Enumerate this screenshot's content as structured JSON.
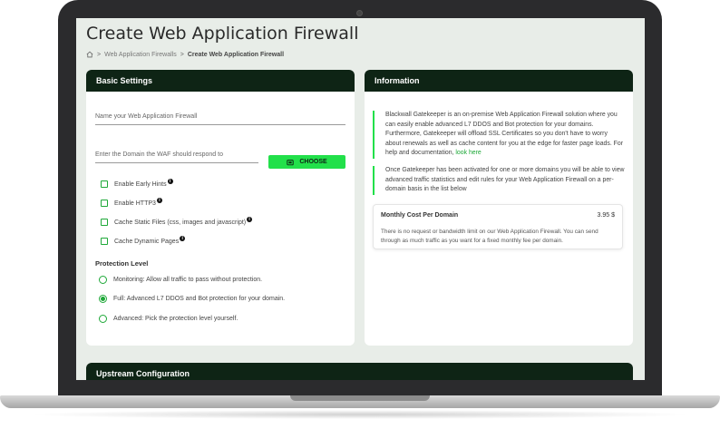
{
  "page": {
    "title": "Create Web Application Firewall",
    "breadcrumb": {
      "home_icon": "home-icon",
      "separator": ">",
      "items": [
        "Web Application Firewalls",
        "Create Web Application Firewall"
      ]
    }
  },
  "basic_settings": {
    "header": "Basic Settings",
    "name_placeholder": "Name your Web Application Firewall",
    "domain_placeholder": "Enter the Domain the WAF should respond to",
    "choose_label": "CHOOSE",
    "choose_icon": "folder-icon",
    "options": [
      {
        "label": "Enable Early Hints",
        "checked": false,
        "has_info": true
      },
      {
        "label": "Enable HTTP3",
        "checked": false,
        "has_info": true
      },
      {
        "label": "Cache Static Files (css, images and javascript)",
        "checked": false,
        "has_info": true
      },
      {
        "label": "Cache Dynamic Pages",
        "checked": false,
        "has_info": true
      }
    ],
    "protection_label": "Protection Level",
    "protection_levels": [
      {
        "label": "Monitoring: Allow all traffic to pass without protection.",
        "selected": false
      },
      {
        "label": "Full: Advanced L7 DDOS and Bot protection for your domain.",
        "selected": true
      },
      {
        "label": "Advanced: Pick the protection level yourself.",
        "selected": false
      }
    ]
  },
  "information": {
    "header": "Information",
    "paragraph1": "Blackwall Gatekeeper is an on-premise Web Application Firewall solution where you can easily enable advanced L7 DDOS and Bot protection for your domains. Furthermore, Gatekeeper will offload SSL Certificates so you don't have to worry about renewals as well as cache content for you at the edge for faster page loads. For help and documentation, ",
    "paragraph1_link": "look here",
    "paragraph2": "Once Gatekeeper has been activated for one or more domains you will be able to view advanced traffic statistics and edit rules for your Web Application Firewall on a per-domain basis in the list below",
    "cost": {
      "title": "Monthly Cost Per Domain",
      "price": "3.95 $",
      "description": "There is no request or bandwidth limit on our Web Application Firewall. You can send through as much traffic as you want for a fixed monthly fee per domain."
    }
  },
  "upstream": {
    "header": "Upstream Configuration"
  },
  "colors": {
    "header_bg": "#0e2415",
    "accent": "#22e04a",
    "screen_bg": "#e8ede8"
  }
}
